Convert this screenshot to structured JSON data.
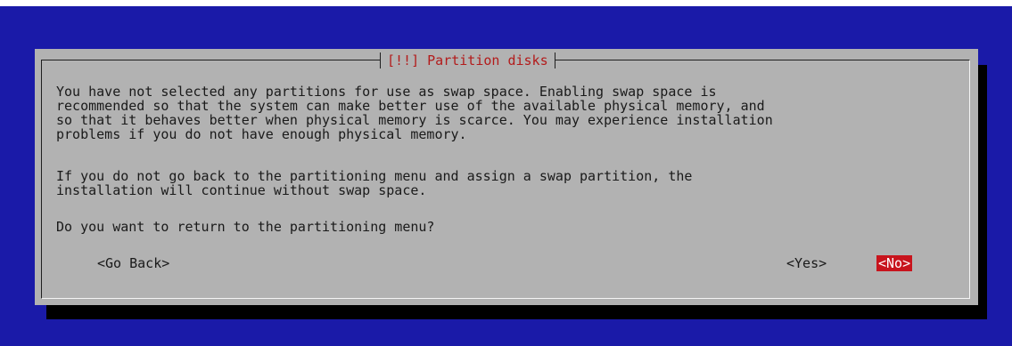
{
  "dialog": {
    "title": "[!!] Partition disks",
    "message_paragraph_1": "You have not selected any partitions for use as swap space. Enabling swap space is\nrecommended so that the system can make better use of the available physical memory, and\nso that it behaves better when physical memory is scarce. You may experience installation\nproblems if you do not have enough physical memory.",
    "message_paragraph_2": "If you do not go back to the partitioning menu and assign a swap partition, the\ninstallation will continue without swap space.",
    "question": "Do you want to return to the partitioning menu?",
    "buttons": {
      "go_back": "<Go Back>",
      "yes": "<Yes>",
      "no": "<No>"
    },
    "selected_button": "no"
  },
  "colors": {
    "background": "#1a1aa8",
    "dialog": "#b2b2b2",
    "title": "#b31b1b",
    "selected_button": "#c8141d",
    "shadow": "#000000"
  }
}
